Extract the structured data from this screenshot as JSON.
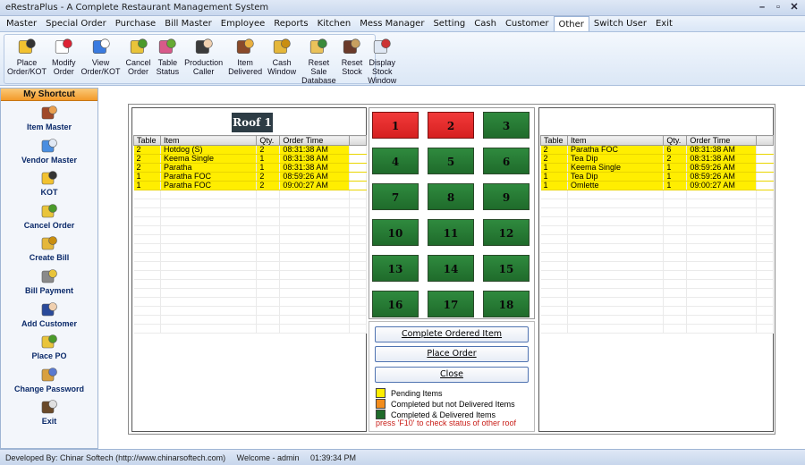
{
  "window": {
    "title": "eRestraPlus - A Complete Restaurant Management System",
    "min": "–",
    "restore": "▫",
    "close": "✕"
  },
  "menu": [
    "Master",
    "Special Order",
    "Purchase",
    "Bill Master",
    "Employee",
    "Reports",
    "Kitchen",
    "Mess Manager",
    "Setting",
    "Cash",
    "Customer",
    "Other",
    "Switch User",
    "Exit"
  ],
  "menu_active": "Other",
  "ribbon": [
    {
      "label": "Place\nOrder/KOT",
      "icon": "place-order-icon"
    },
    {
      "label": "Modify\nOrder",
      "icon": "modify-order-icon"
    },
    {
      "label": "View\nOrder/KOT",
      "icon": "view-order-icon"
    },
    {
      "label": "Cancel\nOrder",
      "icon": "cancel-order-icon"
    },
    {
      "label": "Table\nStatus",
      "icon": "table-status-icon"
    },
    {
      "label": "Production\nCaller",
      "icon": "production-caller-icon"
    },
    {
      "label": "Item\nDelivered",
      "icon": "item-delivered-icon"
    },
    {
      "label": "Cash\nWindow",
      "icon": "cash-window-icon"
    },
    {
      "label": "Reset Sale\nDatabase",
      "icon": "reset-sale-icon"
    },
    {
      "label": "Reset\nStock",
      "icon": "reset-stock-icon"
    },
    {
      "label": "Display Stock\nWindow",
      "icon": "display-stock-icon"
    }
  ],
  "shortcut": {
    "title": "My Shortcut",
    "items": [
      {
        "label": "Item Master",
        "icon": "item-master-icon"
      },
      {
        "label": "Vendor Master",
        "icon": "vendor-master-icon"
      },
      {
        "label": "KOT",
        "icon": "kot-icon"
      },
      {
        "label": "Cancel Order",
        "icon": "cancel-order-icon"
      },
      {
        "label": "Create Bill",
        "icon": "create-bill-icon"
      },
      {
        "label": "Bill Payment",
        "icon": "bill-payment-icon"
      },
      {
        "label": "Add Customer",
        "icon": "add-customer-icon"
      },
      {
        "label": "Place PO",
        "icon": "place-po-icon"
      },
      {
        "label": "Change Password",
        "icon": "change-password-icon"
      },
      {
        "label": "Exit",
        "icon": "exit-icon"
      }
    ]
  },
  "roof_title": "Roof 1",
  "columns": [
    "Table",
    "Item",
    "Qty.",
    "Order Time"
  ],
  "left_orders": [
    {
      "table": "2",
      "item": "Hotdog (S)",
      "qty": "2",
      "time": "08:31:38 AM"
    },
    {
      "table": "2",
      "item": "Keema Single",
      "qty": "1",
      "time": "08:31:38 AM"
    },
    {
      "table": "2",
      "item": "Paratha",
      "qty": "1",
      "time": "08:31:38 AM"
    },
    {
      "table": "1",
      "item": "Paratha FOC",
      "qty": "2",
      "time": "08:59:26 AM"
    },
    {
      "table": "1",
      "item": "Paratha FOC",
      "qty": "2",
      "time": "09:00:27 AM"
    }
  ],
  "right_orders": [
    {
      "table": "2",
      "item": "Paratha FOC",
      "qty": "6",
      "time": "08:31:38 AM"
    },
    {
      "table": "2",
      "item": "Tea Dip",
      "qty": "2",
      "time": "08:31:38 AM"
    },
    {
      "table": "1",
      "item": "Keema Single",
      "qty": "1",
      "time": "08:59:26 AM"
    },
    {
      "table": "1",
      "item": "Tea Dip",
      "qty": "1",
      "time": "08:59:26 AM"
    },
    {
      "table": "1",
      "item": "Omlette",
      "qty": "1",
      "time": "09:00:27 AM"
    }
  ],
  "tables": [
    {
      "num": "1",
      "status": "red"
    },
    {
      "num": "2",
      "status": "red"
    },
    {
      "num": "3",
      "status": "green"
    },
    {
      "num": "4",
      "status": "green"
    },
    {
      "num": "5",
      "status": "green"
    },
    {
      "num": "6",
      "status": "green"
    },
    {
      "num": "7",
      "status": "green"
    },
    {
      "num": "8",
      "status": "green"
    },
    {
      "num": "9",
      "status": "green"
    },
    {
      "num": "10",
      "status": "green"
    },
    {
      "num": "11",
      "status": "green"
    },
    {
      "num": "12",
      "status": "green"
    },
    {
      "num": "13",
      "status": "green"
    },
    {
      "num": "14",
      "status": "green"
    },
    {
      "num": "15",
      "status": "green"
    },
    {
      "num": "16",
      "status": "green"
    },
    {
      "num": "17",
      "status": "green"
    },
    {
      "num": "18",
      "status": "green"
    }
  ],
  "buttons": {
    "complete": "Complete Ordered Item",
    "place": "Place Order",
    "close": "Close"
  },
  "legend": [
    {
      "label": "Pending Items",
      "color": "#ffee00"
    },
    {
      "label": "Completed but not Delivered Items",
      "color": "#f28c1c"
    },
    {
      "label": "Completed & Delivered Items",
      "color": "#1f6b2b"
    }
  ],
  "hint": "press 'F10' to check status of other roof",
  "status": {
    "developer": "Developed By: Chinar Softech (http://www.chinarsoftech.com)",
    "welcome": "Welcome - admin",
    "time": "01:39:34 PM"
  },
  "colors": {
    "pending": "#ffee00",
    "occupied": "#e02525",
    "free": "#247a33",
    "accent": "#f39a2a"
  }
}
